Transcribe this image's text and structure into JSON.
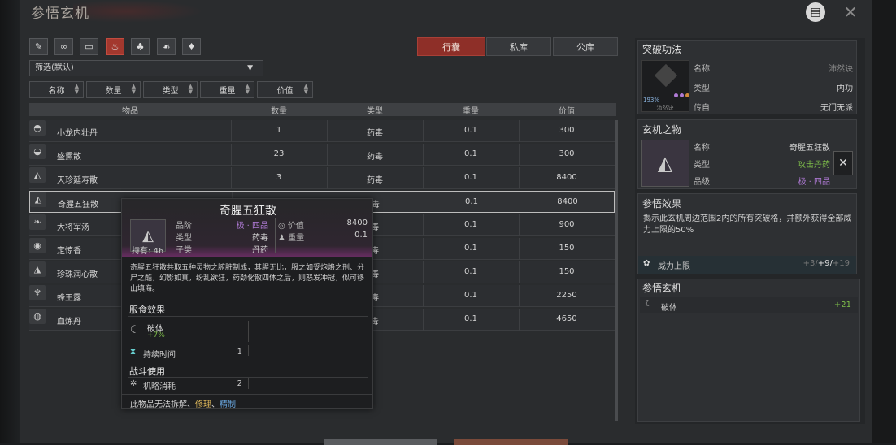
{
  "header": {
    "title": "参悟玄机"
  },
  "tabs": [
    {
      "label": "行囊",
      "active": true
    },
    {
      "label": "私库",
      "active": false
    },
    {
      "label": "公库",
      "active": false
    }
  ],
  "filter": {
    "value": "筛选(默认)"
  },
  "sort": [
    "名称",
    "数量",
    "类型",
    "重量",
    "价值"
  ],
  "columns": [
    "物品",
    "数量",
    "类型",
    "重量",
    "价值"
  ],
  "rows": [
    {
      "name": "小龙内壮丹",
      "qty": "1",
      "type": "药毒",
      "weight": "0.1",
      "value": "300"
    },
    {
      "name": "盛熏散",
      "qty": "23",
      "type": "药毒",
      "weight": "0.1",
      "value": "300"
    },
    {
      "name": "天珍延寿散",
      "qty": "3",
      "type": "药毒",
      "weight": "0.1",
      "value": "8400"
    },
    {
      "name": "奇腥五狂散",
      "qty": "",
      "type": "毒",
      "weight": "0.1",
      "value": "8400"
    },
    {
      "name": "大将军汤",
      "qty": "",
      "type": "毒",
      "weight": "0.1",
      "value": "900"
    },
    {
      "name": "定惊香",
      "qty": "",
      "type": "毒",
      "weight": "0.1",
      "value": "150"
    },
    {
      "name": "珍珠润心散",
      "qty": "",
      "type": "毒",
      "weight": "0.1",
      "value": "150"
    },
    {
      "name": "蜂王露",
      "qty": "",
      "type": "毒",
      "weight": "0.1",
      "value": "2250"
    },
    {
      "name": "血炼丹",
      "qty": "",
      "type": "毒",
      "weight": "0.1",
      "value": "4650"
    }
  ],
  "tooltip": {
    "title": "奇腥五狂散",
    "grade_label": "品阶",
    "grade": "极 · 四品",
    "price_label": "价值",
    "price": "8400",
    "type_label": "类型",
    "type": "药毒",
    "weight_label": "重量",
    "weight": "0.1",
    "sub_label": "子类",
    "sub": "丹药",
    "owned": "持有: 46",
    "desc": "奇腥五狂散共取五种灵物之腑脏制成，其腥无比，服之如受炮烙之刑、分尸之酷，幻影如真，纷乱欲狂，药劲化散四体之后，则怒发冲冠，似可移山填海。",
    "eat_title": "服食效果",
    "eat_name": "破体",
    "eat_val": "+7%",
    "dur_name": "持续时间",
    "dur_val": "1",
    "battle_title": "战斗使用",
    "cost_name": "机略消耗",
    "cost_val": "2",
    "footer_prefix": "此物品无法拆解、",
    "footer_repair": "修理",
    "footer_sep": "、",
    "footer_refine": "精制"
  },
  "right": {
    "breakthrough": {
      "title": "突破功法",
      "name_k": "名称",
      "name_v": "沛然诀",
      "type_k": "类型",
      "type_v": "内功",
      "from_k": "传自",
      "from_v": "无门无派",
      "pct": "193%",
      "caption": "沛然诀"
    },
    "item": {
      "title": "玄机之物",
      "name_k": "名称",
      "name_v": "奇腥五狂散",
      "type_k": "类型",
      "type_v": "攻击丹药",
      "grade_k": "品级",
      "grade_v": "极 · 四品"
    },
    "effect": {
      "title": "参悟效果",
      "text": "揭示此玄机周边范围2内的所有突破格，并额外获得全部威力上限的50%",
      "limit_label": "威力上限",
      "limit_val1": "+3/",
      "limit_val2": "+9/",
      "limit_val3": "+19"
    },
    "insight": {
      "title": "参悟玄机",
      "name": "破体",
      "val": "+21"
    }
  },
  "colors": {
    "accent": "#8e2f28",
    "purple": "#b07ad6",
    "green": "#7fbf4a",
    "gold": "#d9b45a"
  }
}
